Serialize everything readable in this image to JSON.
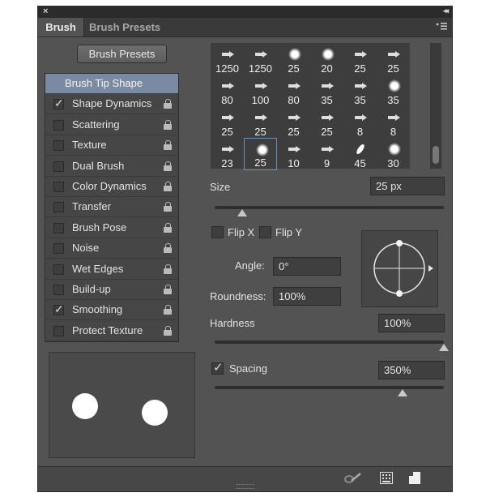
{
  "window": {
    "close_glyph": "×",
    "collapse_glyph": "◂◂"
  },
  "tabs": [
    {
      "label": "Brush",
      "active": true
    },
    {
      "label": "Brush Presets",
      "active": false
    }
  ],
  "panel_menu_icon": "panel-menu-icon",
  "brush_presets_button": "Brush Presets",
  "options": [
    {
      "label": "Brush Tip Shape",
      "checked": null,
      "selected": true
    },
    {
      "label": "Shape Dynamics",
      "checked": true
    },
    {
      "label": "Scattering",
      "checked": false
    },
    {
      "label": "Texture",
      "checked": false
    },
    {
      "label": "Dual Brush",
      "checked": false
    },
    {
      "label": "Color Dynamics",
      "checked": false
    },
    {
      "label": "Transfer",
      "checked": false
    },
    {
      "label": "Brush Pose",
      "checked": false
    },
    {
      "label": "Noise",
      "checked": false
    },
    {
      "label": "Wet Edges",
      "checked": false
    },
    {
      "label": "Build-up",
      "checked": false
    },
    {
      "label": "Smoothing",
      "checked": true
    },
    {
      "label": "Protect Texture",
      "checked": false
    }
  ],
  "brush_grid": [
    [
      "1250",
      "1250",
      "25",
      "20",
      "25",
      "25"
    ],
    [
      "80",
      "100",
      "80",
      "35",
      "35",
      "35"
    ],
    [
      "25",
      "25",
      "25",
      "25",
      "8",
      "8"
    ],
    [
      "23",
      "25",
      "10",
      "9",
      "45",
      "30"
    ]
  ],
  "selected_brush": {
    "row": 3,
    "col": 1
  },
  "size": {
    "label": "Size",
    "value": "25 px",
    "slider": 0.12
  },
  "flip_x": {
    "label": "Flip X",
    "checked": false
  },
  "flip_y": {
    "label": "Flip Y",
    "checked": false
  },
  "angle": {
    "label": "Angle:",
    "value": "0°"
  },
  "roundness": {
    "label": "Roundness:",
    "value": "100%"
  },
  "hardness": {
    "label": "Hardness",
    "value": "100%",
    "slider": 1.0
  },
  "spacing": {
    "label": "Spacing",
    "checked": true,
    "value": "350%",
    "slider": 0.82
  },
  "bottom_icons": [
    "brush-tool-icon",
    "grid-icon",
    "new-preset-icon"
  ],
  "colors": {
    "panel": "#535353",
    "selection": "#7a8aa2"
  }
}
